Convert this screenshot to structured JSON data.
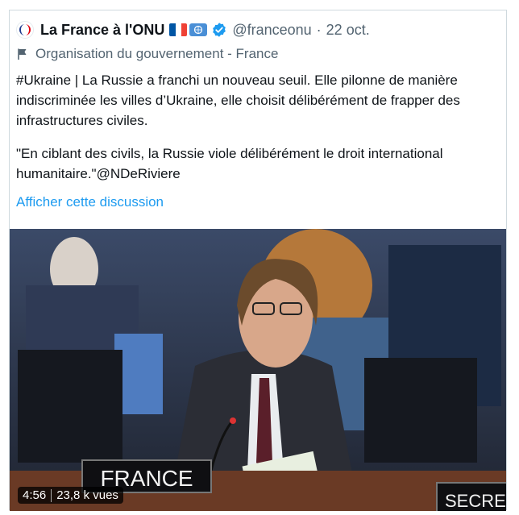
{
  "tweet": {
    "display_name": "La France à l'ONU",
    "handle": "@franceonu",
    "dot": "·",
    "date": "22 oct.",
    "affiliation": "Organisation du gouvernement - France",
    "paragraph1": "#Ukraine | La Russie a franchi un nouveau seuil. Elle pilonne de manière indiscriminée les villes d’Ukraine, elle choisit délibérément de frapper des infrastructures civiles.",
    "paragraph2": "\"En ciblant des civils, la Russie viole délibérément le droit international humanitaire.\"@NDeRiviere",
    "show_thread": "Afficher cette discussion",
    "video": {
      "duration": "4:56",
      "views": "23,8 k vues",
      "nameplate": "FRANCE",
      "nameplate_right": "SECRET"
    },
    "colors": {
      "link": "#1d9bf0",
      "verified": "#1d9bf0",
      "muted": "#536471"
    }
  }
}
